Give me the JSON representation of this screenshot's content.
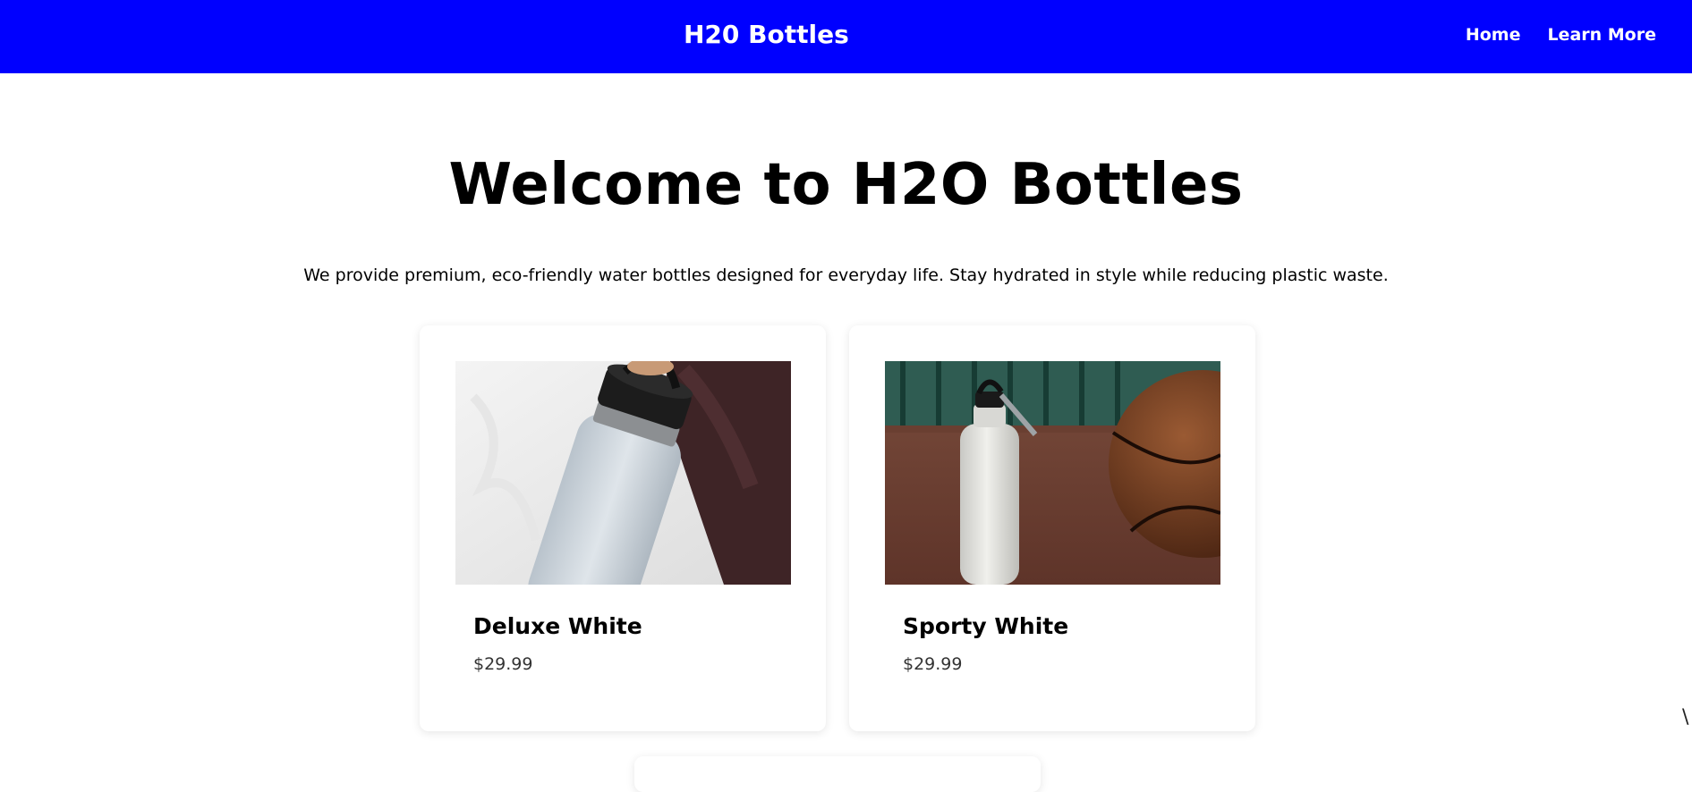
{
  "navbar": {
    "brand": "H20 Bottles",
    "links": [
      "Home",
      "Learn More"
    ],
    "background": "#0000ff"
  },
  "hero": {
    "title": "Welcome to H2O Bottles",
    "text": "We provide premium, eco-friendly water bottles designed for everyday life. Stay hydrated in style while reducing plastic waste."
  },
  "products": [
    {
      "name": "Deluxe White",
      "price": "$29.99",
      "image": "white-insulated-bottle-photo"
    },
    {
      "name": "Sporty White",
      "price": "$29.99",
      "image": "white-sports-bottle-basketball-photo"
    }
  ],
  "edge_glyph": "\\"
}
